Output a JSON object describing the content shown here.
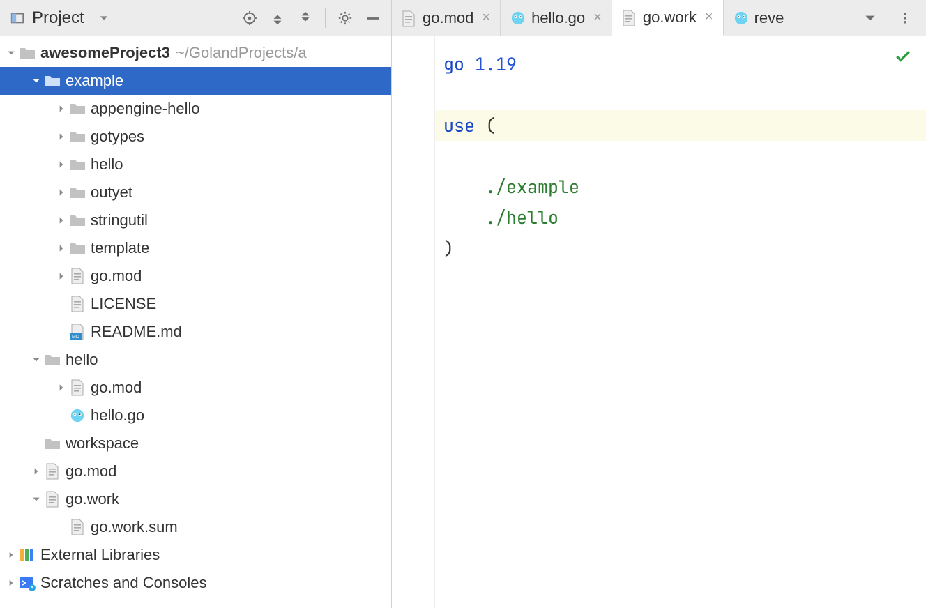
{
  "sidebar": {
    "title": "Project",
    "root": {
      "name": "awesomeProject3",
      "path": "~/GolandProjects/a"
    },
    "tree": [
      {
        "label": "example",
        "kind": "folder",
        "depth": 1,
        "arrow": "down",
        "selected": true
      },
      {
        "label": "appengine-hello",
        "kind": "folder",
        "depth": 2,
        "arrow": "right"
      },
      {
        "label": "gotypes",
        "kind": "folder",
        "depth": 2,
        "arrow": "right"
      },
      {
        "label": "hello",
        "kind": "folder",
        "depth": 2,
        "arrow": "right"
      },
      {
        "label": "outyet",
        "kind": "folder",
        "depth": 2,
        "arrow": "right"
      },
      {
        "label": "stringutil",
        "kind": "folder",
        "depth": 2,
        "arrow": "right"
      },
      {
        "label": "template",
        "kind": "folder",
        "depth": 2,
        "arrow": "right"
      },
      {
        "label": "go.mod",
        "kind": "file",
        "depth": 2,
        "arrow": "right"
      },
      {
        "label": "LICENSE",
        "kind": "file",
        "depth": 2,
        "arrow": ""
      },
      {
        "label": "README.md",
        "kind": "md",
        "depth": 2,
        "arrow": ""
      },
      {
        "label": "hello",
        "kind": "folder",
        "depth": 1,
        "arrow": "down"
      },
      {
        "label": "go.mod",
        "kind": "file",
        "depth": 2,
        "arrow": "right"
      },
      {
        "label": "hello.go",
        "kind": "go",
        "depth": 2,
        "arrow": ""
      },
      {
        "label": "workspace",
        "kind": "folder",
        "depth": 1,
        "arrow": ""
      },
      {
        "label": "go.mod",
        "kind": "file",
        "depth": 1,
        "arrow": "right"
      },
      {
        "label": "go.work",
        "kind": "file",
        "depth": 1,
        "arrow": "down"
      },
      {
        "label": "go.work.sum",
        "kind": "file",
        "depth": 2,
        "arrow": ""
      }
    ],
    "extLibs": "External Libraries",
    "scratches": "Scratches and Consoles"
  },
  "tabs": [
    {
      "label": "go.mod",
      "icon": "file",
      "active": false
    },
    {
      "label": "hello.go",
      "icon": "go",
      "active": false
    },
    {
      "label": "go.work",
      "icon": "file",
      "active": true
    },
    {
      "label": "reve",
      "icon": "go",
      "active": false,
      "noclose": true
    }
  ],
  "code": {
    "l1a": "go",
    "l1b": "1.19",
    "l3a": "use",
    "l3b": "(",
    "l4": "./example",
    "l5": "./hello",
    "l6": ")"
  }
}
